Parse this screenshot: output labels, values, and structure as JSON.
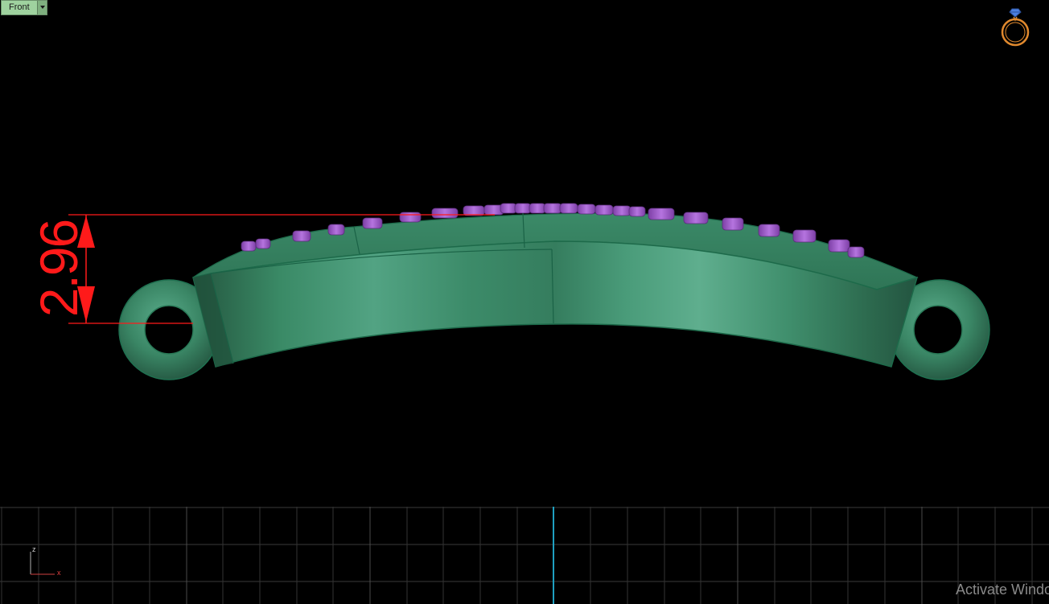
{
  "viewport": {
    "view_name": "Front",
    "dimension_value": "2.96",
    "axis_z_label": "z",
    "axis_x_label": "x",
    "watermark_text": "Activate Windows",
    "view_cube_icon": "ring-icon",
    "colors": {
      "background": "#000000",
      "model_body": "#3f9a78",
      "gem_color": "#a05cc8",
      "dimension_color": "#ff1a1a",
      "grid_line": "#3a3a3a",
      "grid_center": "#1fa0c0"
    }
  }
}
